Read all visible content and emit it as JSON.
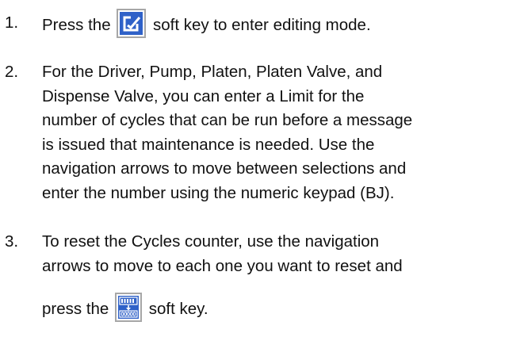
{
  "steps": [
    {
      "number": "1.",
      "text_before_icon": "Press the",
      "icon": "edit-mode-icon",
      "text_after_icon": "soft key to enter editing mode."
    },
    {
      "number": "2.",
      "lines": [
        "For the Driver, Pump, Platen, Platen Valve, and",
        "Dispense Valve, you can enter a Limit for the",
        "number of cycles that can be run before a message",
        "is issued that maintenance is needed. Use the",
        "navigation arrows to move between selections and",
        "enter the number using the numeric keypad (BJ)."
      ]
    },
    {
      "number": "3.",
      "lines": [
        "To reset the Cycles counter, use the navigation",
        "arrows to move to each one you want to reset and"
      ],
      "text_before_icon": "press the",
      "icon": "reset-counter-icon",
      "text_after_icon": "soft key."
    }
  ],
  "colors": {
    "text": "#111111",
    "icon_blue": "#2f61c8",
    "icon_border": "#a7a7a7"
  }
}
